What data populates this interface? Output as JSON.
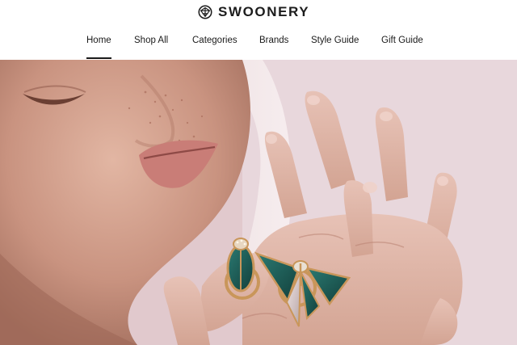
{
  "header": {
    "brand_name": "SWOONERY",
    "brand_icon": "origami-bird-logo-icon"
  },
  "nav": {
    "items": [
      {
        "label": "Home",
        "active": true
      },
      {
        "label": "Shop All",
        "active": false
      },
      {
        "label": "Categories",
        "active": false
      },
      {
        "label": "Brands",
        "active": false
      },
      {
        "label": "Style Guide",
        "active": false
      },
      {
        "label": "Gift Guide",
        "active": false
      }
    ]
  },
  "hero": {
    "image": "woman-wearing-beetle-and-butterfly-rings-photo"
  },
  "colors": {
    "text": "#1a1a1a",
    "ring_green": "#1f5b55",
    "ring_gold": "#c9965a"
  }
}
